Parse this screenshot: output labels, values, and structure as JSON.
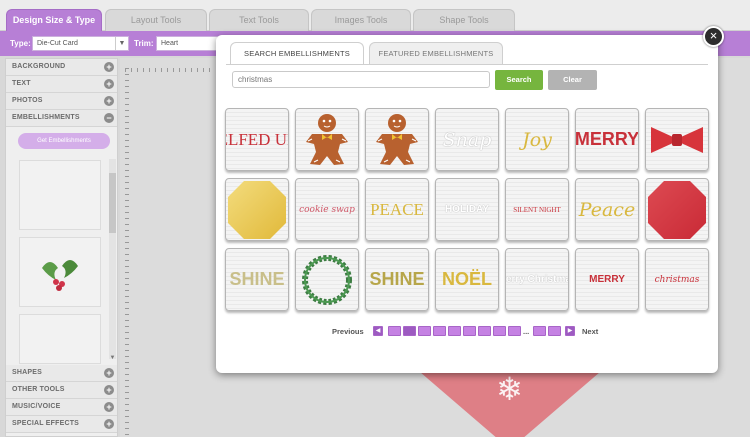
{
  "top_tabs": [
    {
      "label": "Design Size & Type",
      "active": true
    },
    {
      "label": "Layout Tools",
      "active": false
    },
    {
      "label": "Text Tools",
      "active": false
    },
    {
      "label": "Images Tools",
      "active": false
    },
    {
      "label": "Shape Tools",
      "active": false
    }
  ],
  "toolbar": {
    "type_label": "Type:",
    "type_value": "Die-Cut Card",
    "trim_label": "Trim:",
    "trim_value": "Heart"
  },
  "sidebar": {
    "sections_top": [
      "BACKGROUND",
      "TEXT",
      "PHOTOS",
      "EMBELLISHMENTS"
    ],
    "get_button": "Get Embellishments",
    "sections_bottom": [
      "SHAPES",
      "OTHER TOOLS",
      "MUSIC/VOICE",
      "SPECIAL EFFECTS"
    ]
  },
  "modal": {
    "tab_search": "SEARCH EMBELLISHMENTS",
    "tab_featured": "FEATURED EMBELLISHMENTS",
    "search_value": "christmas",
    "search_button": "Search",
    "clear_button": "Clear",
    "close_glyph": "×",
    "items": [
      {
        "text": "ELFED UP",
        "color": "#c8313a",
        "kind": "text"
      },
      {
        "text": "",
        "kind": "gingerbread"
      },
      {
        "text": "",
        "kind": "gingerbread"
      },
      {
        "text": "Snap",
        "color": "#ffffff",
        "kind": "script-light"
      },
      {
        "text": "Joy",
        "color": "#d9b83f",
        "kind": "script"
      },
      {
        "text": "MERRY",
        "color": "#c8313a",
        "kind": "text-bold"
      },
      {
        "text": "",
        "kind": "bow"
      },
      {
        "text": "",
        "kind": "gold-octagon"
      },
      {
        "text": "cookie swap",
        "color": "#d05a6a",
        "kind": "script-small"
      },
      {
        "text": "PEACE",
        "color": "#d9b83f",
        "kind": "text"
      },
      {
        "text": "HOLIDAY",
        "color": "#ffffff",
        "kind": "text-light"
      },
      {
        "text": "SILENT NIGHT",
        "color": "#c8313a",
        "kind": "text-small"
      },
      {
        "text": "Peace",
        "color": "#d9b83f",
        "kind": "script"
      },
      {
        "text": "",
        "kind": "red-octagon"
      },
      {
        "text": "SHINE",
        "color": "#c9bf8a",
        "kind": "text-bold"
      },
      {
        "text": "",
        "kind": "wreath"
      },
      {
        "text": "SHINE",
        "color": "#b7a64a",
        "kind": "text-bold"
      },
      {
        "text": "NOËL",
        "color": "#d9b83f",
        "kind": "text-bold"
      },
      {
        "text": "Merry Christmas",
        "color": "#ffffff",
        "kind": "text-light"
      },
      {
        "text": "MERRY",
        "color": "#c8313a",
        "kind": "text-small-bold"
      },
      {
        "text": "christmas",
        "color": "#c8313a",
        "kind": "script-small"
      }
    ],
    "pager": {
      "previous": "Previous",
      "next": "Next",
      "ellipsis": "..."
    }
  },
  "colors": {
    "accent_purple": "#b77fd6",
    "search_green": "#76b53e",
    "clear_gray": "#b3b3b3"
  }
}
